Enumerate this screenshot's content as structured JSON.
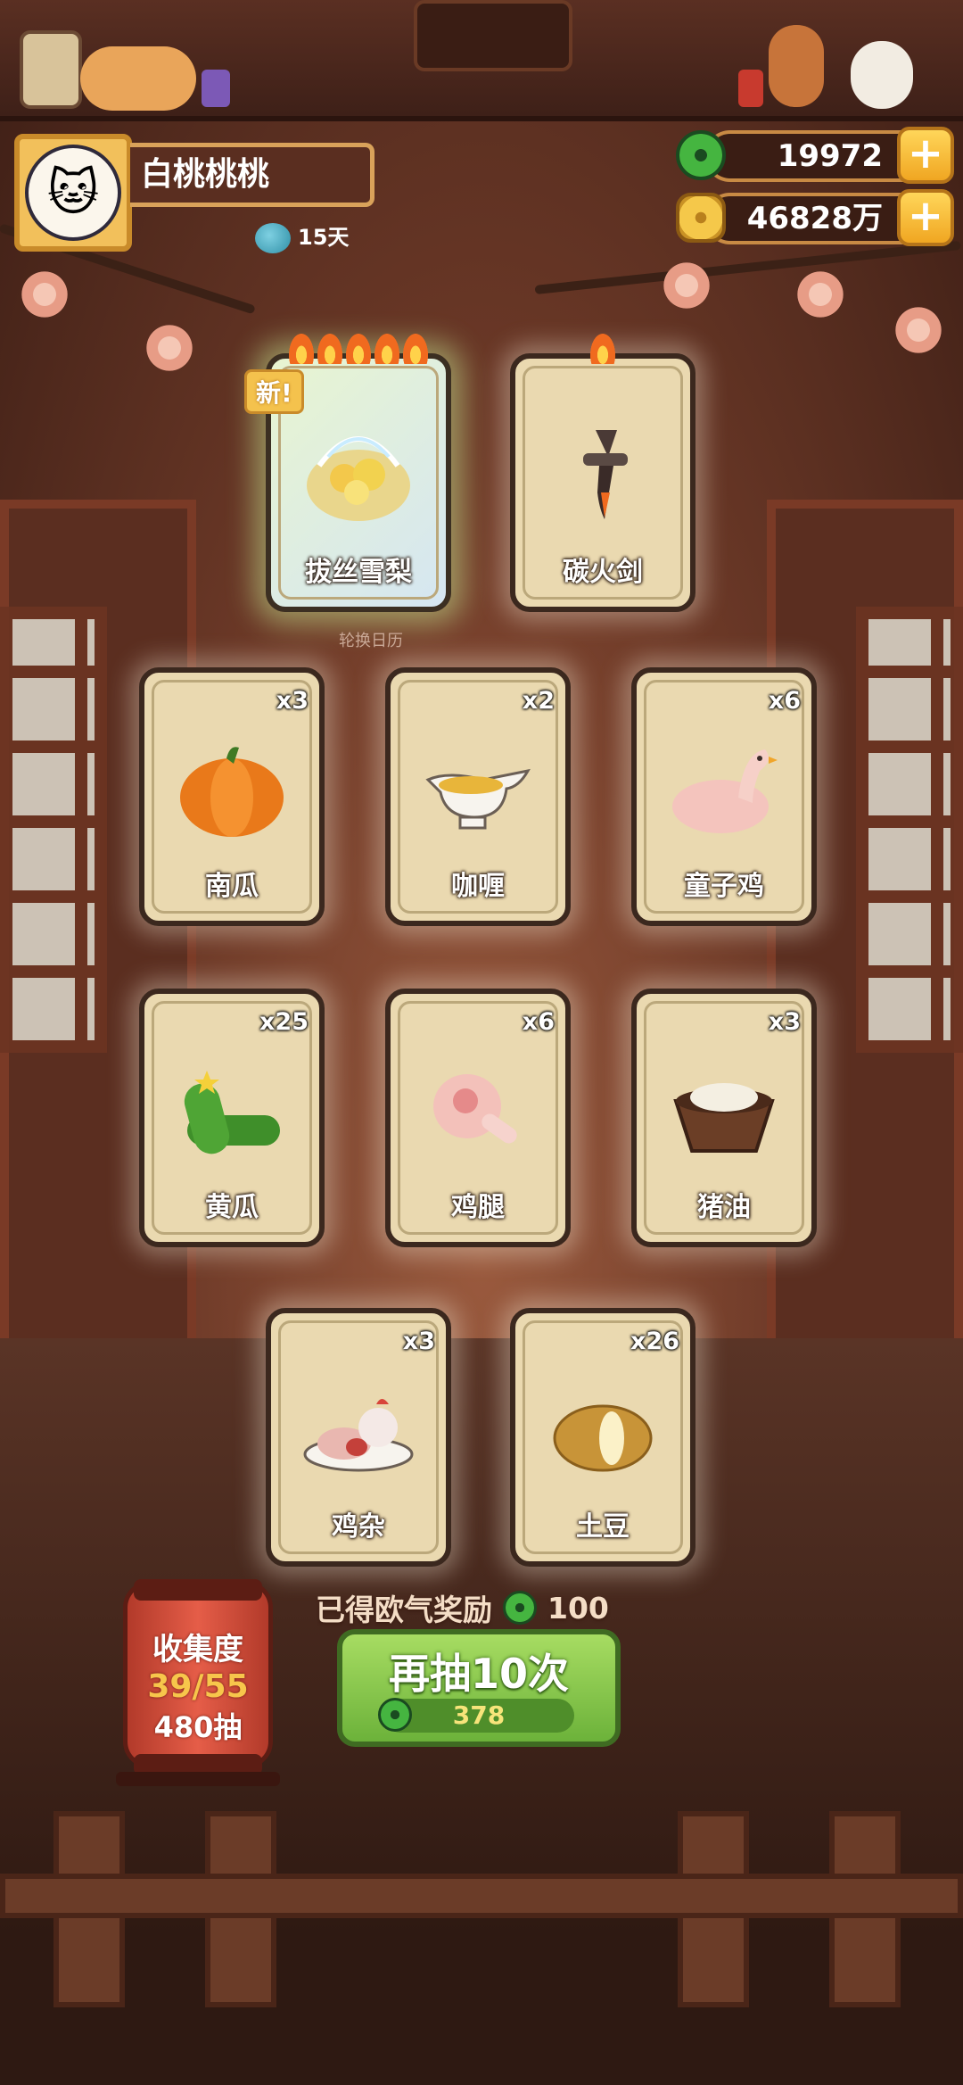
{
  "player": {
    "name": "白桃桃桃",
    "days": "15天"
  },
  "currency": {
    "jade": "19972",
    "coins": "46828万"
  },
  "featured_cards": [
    {
      "name": "拔丝雪梨",
      "badge": "新!",
      "flames": 5
    },
    {
      "name": "碳火剑",
      "flames": 1
    }
  ],
  "calendar_caption": "轮换日历",
  "cards": [
    {
      "name": "南瓜",
      "count": "x3",
      "icon": "pumpkin-icon"
    },
    {
      "name": "咖喱",
      "count": "x2",
      "icon": "curry-boat-icon"
    },
    {
      "name": "童子鸡",
      "count": "x6",
      "icon": "young-chicken-icon"
    },
    {
      "name": "黄瓜",
      "count": "x25",
      "icon": "cucumber-icon"
    },
    {
      "name": "鸡腿",
      "count": "x6",
      "icon": "chicken-leg-icon"
    },
    {
      "name": "猪油",
      "count": "x3",
      "icon": "lard-bowl-icon"
    },
    {
      "name": "鸡杂",
      "count": "x3",
      "icon": "chicken-giblets-icon"
    },
    {
      "name": "土豆",
      "count": "x26",
      "icon": "potato-icon"
    }
  ],
  "reward": {
    "label": "已得欧气奖励",
    "value": "100"
  },
  "draw_button": {
    "label": "再抽10次",
    "cost": "378"
  },
  "collection": {
    "title": "收集度",
    "progress": "39/55",
    "draws": "480抽"
  }
}
